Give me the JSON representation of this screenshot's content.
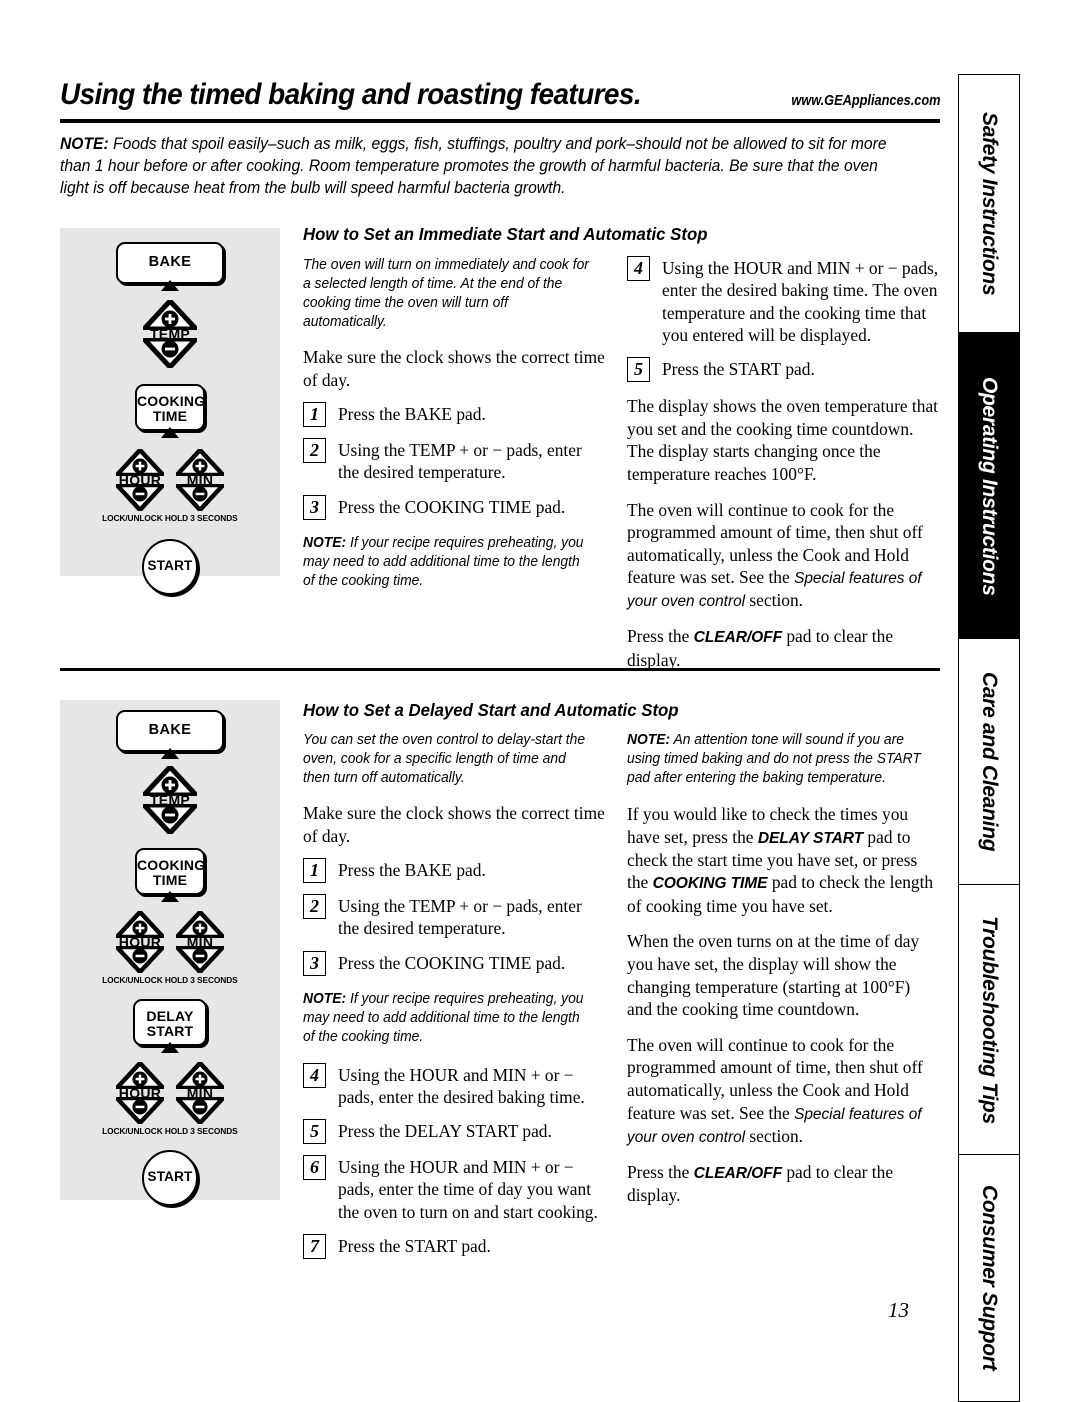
{
  "header": {
    "title": "Using the timed baking and roasting features.",
    "url": "www.GEAppliances.com",
    "note_label": "NOTE:",
    "note_text": " Foods that spoil easily–such as milk, eggs, fish, stuffings, poultry and pork–should not be allowed to sit for more than 1 hour before or after cooking. Room temperature promotes the growth of harmful bacteria. Be sure that the oven light is off because heat from the bulb will speed harmful bacteria growth."
  },
  "control_panel": {
    "bake": "BAKE",
    "temp": "TEMP",
    "cooking_time_line1": "COOKING",
    "cooking_time_line2": "TIME",
    "hour": "HOUR",
    "min": "MIN",
    "lock_note": "LOCK/UNLOCK HOLD 3 SECONDS",
    "delay_line1": "DELAY",
    "delay_line2": "START",
    "start": "START",
    "plus": "+",
    "minus": "−"
  },
  "section1": {
    "heading": "How to Set an Immediate Start and Automatic Stop",
    "intro": "The oven will turn on immediately and cook for a selected length of time. At the end of the cooking time the oven will turn off automatically.",
    "clock_note": "Make sure the clock shows the correct time of day.",
    "steps": [
      {
        "num": "1",
        "parts": [
          {
            "t": "Press the ",
            "s": "n"
          },
          {
            "t": "BAKE",
            "s": "b"
          },
          {
            "t": " pad.",
            "s": "n"
          }
        ]
      },
      {
        "num": "2",
        "parts": [
          {
            "t": "Using the ",
            "s": "n"
          },
          {
            "t": "TEMP +",
            "s": "b"
          },
          {
            "t": " or − pads, enter the desired temperature.",
            "s": "n"
          }
        ]
      },
      {
        "num": "3",
        "parts": [
          {
            "t": "Press the ",
            "s": "n"
          },
          {
            "t": "COOKING TIME",
            "s": "b"
          },
          {
            "t": " pad.",
            "s": "n"
          }
        ]
      }
    ],
    "note_label": "NOTE:",
    "note_text": " If your recipe requires preheating, you may need to add additional time to the length of the cooking time.",
    "steps_right": [
      {
        "num": "4",
        "parts": [
          {
            "t": "Using the ",
            "s": "n"
          },
          {
            "t": "HOUR",
            "s": "b"
          },
          {
            "t": " and ",
            "s": "n"
          },
          {
            "t": "MIN +",
            "s": "b"
          },
          {
            "t": " or − pads, enter the desired baking time. The oven temperature and the cooking time that you entered will be displayed.",
            "s": "n"
          }
        ]
      },
      {
        "num": "5",
        "parts": [
          {
            "t": "Press the ",
            "s": "n"
          },
          {
            "t": "START",
            "s": "b"
          },
          {
            "t": " pad.",
            "s": "n"
          }
        ]
      }
    ],
    "para_display": "The display shows the oven temperature that you set and the cooking time countdown. The display starts changing once the temperature reaches 100°F.",
    "para_continue_a": "The oven will continue to cook for the programmed amount of time, then shut off automatically, unless the Cook and Hold feature was set. See the ",
    "para_continue_special": "Special features of your oven control",
    "para_continue_b": " section.",
    "para_clear_a": "Press the ",
    "para_clear_pad": "CLEAR/OFF",
    "para_clear_b": " pad to clear the display."
  },
  "section2": {
    "heading": "How to Set a Delayed Start and Automatic Stop",
    "intro": "You can set the oven control to delay-start the oven, cook for a specific length of time and then turn off automatically.",
    "clock_note": "Make sure the clock shows the correct time of day.",
    "steps": [
      {
        "num": "1",
        "parts": [
          {
            "t": "Press the ",
            "s": "n"
          },
          {
            "t": "BAKE",
            "s": "b"
          },
          {
            "t": " pad.",
            "s": "n"
          }
        ]
      },
      {
        "num": "2",
        "parts": [
          {
            "t": "Using the ",
            "s": "n"
          },
          {
            "t": "TEMP +",
            "s": "b"
          },
          {
            "t": " or − pads, enter the desired temperature.",
            "s": "n"
          }
        ]
      },
      {
        "num": "3",
        "parts": [
          {
            "t": "Press the ",
            "s": "n"
          },
          {
            "t": "COOKING TIME",
            "s": "b"
          },
          {
            "t": " pad.",
            "s": "n"
          }
        ]
      }
    ],
    "note_label": "NOTE:",
    "note_text": " If your recipe requires preheating, you may need to add additional time to the length of the cooking time.",
    "steps_after_note": [
      {
        "num": "4",
        "parts": [
          {
            "t": "Using the ",
            "s": "n"
          },
          {
            "t": "HOUR",
            "s": "b"
          },
          {
            "t": " and ",
            "s": "n"
          },
          {
            "t": "MIN +",
            "s": "b"
          },
          {
            "t": " or − pads, enter the desired baking time.",
            "s": "n"
          }
        ]
      },
      {
        "num": "5",
        "parts": [
          {
            "t": "Press the ",
            "s": "n"
          },
          {
            "t": "DELAY START",
            "s": "b"
          },
          {
            "t": " pad.",
            "s": "n"
          }
        ]
      },
      {
        "num": "6",
        "parts": [
          {
            "t": "Using the ",
            "s": "n"
          },
          {
            "t": "HOUR",
            "s": "b"
          },
          {
            "t": " and ",
            "s": "n"
          },
          {
            "t": "MIN +",
            "s": "b"
          },
          {
            "t": " or − pads, enter the time of day you want the oven to turn on and start cooking.",
            "s": "n"
          }
        ]
      },
      {
        "num": "7",
        "parts": [
          {
            "t": "Press the ",
            "s": "n"
          },
          {
            "t": "START",
            "s": "b"
          },
          {
            "t": " pad.",
            "s": "n"
          }
        ]
      }
    ],
    "note2_label": "NOTE:",
    "note2_text": " An attention tone will sound if you are using timed baking and do not press the START pad after entering the baking temperature.",
    "para_check_a": "If you would like to check the times you have set, press the ",
    "para_check_pad1": "DELAY START",
    "para_check_b": " pad to check the start time you have set, or press the ",
    "para_check_pad2": "COOKING TIME",
    "para_check_c": " pad to check the length of cooking time you have set.",
    "para_when": "When the oven turns on at the time of day you have set, the display will show the changing temperature (starting at 100°F) and the cooking time countdown.",
    "para_continue_a": "The oven will continue to cook for the programmed amount of time, then shut off automatically, unless the Cook and Hold feature was set. See the ",
    "para_continue_special": "Special features of your oven control",
    "para_continue_b": " section.",
    "para_clear_a": "Press the ",
    "para_clear_pad": "CLEAR/OFF",
    "para_clear_b": " pad to clear the display."
  },
  "sidebar": {
    "tabs": [
      {
        "label": "Safety Instructions",
        "active": false
      },
      {
        "label": "Operating Instructions",
        "active": true
      },
      {
        "label": "Care and Cleaning",
        "active": false
      },
      {
        "label": "Troubleshooting Tips",
        "active": false
      },
      {
        "label": "Consumer Support",
        "active": false
      }
    ]
  },
  "page_number": "13"
}
